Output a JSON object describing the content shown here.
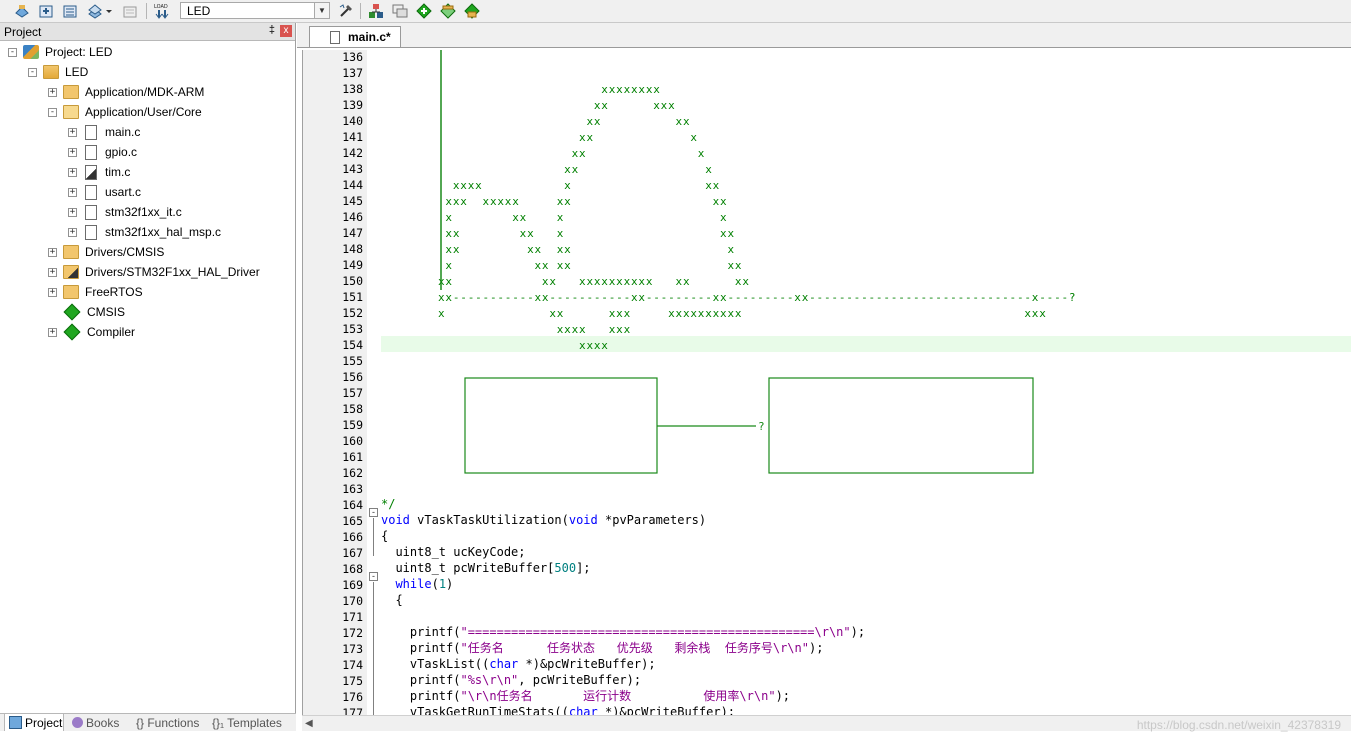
{
  "toolbar": {
    "target": "LED",
    "colors": {
      "accent_green": "#1fa61f",
      "accent_red": "#d9534f"
    }
  },
  "project_panel": {
    "title": "Project",
    "pin_glyph": "‡",
    "close_glyph": "x",
    "tree": [
      {
        "label": "Project: LED",
        "icon": "project-icon",
        "expand": "-"
      },
      {
        "label": "LED",
        "icon": "target-folder-icon",
        "expand": "-"
      },
      {
        "label": "Application/MDK-ARM",
        "icon": "folder-icon",
        "expand": "+"
      },
      {
        "label": "Application/User/Core",
        "icon": "folder-icon",
        "expand": "-"
      },
      {
        "label": "main.c",
        "icon": "file-icon",
        "expand": "+"
      },
      {
        "label": "gpio.c",
        "icon": "file-icon",
        "expand": "+"
      },
      {
        "label": "tim.c",
        "icon": "file-icon",
        "expand": "+"
      },
      {
        "label": "usart.c",
        "icon": "file-icon",
        "expand": "+"
      },
      {
        "label": "stm32f1xx_it.c",
        "icon": "file-icon",
        "expand": "+"
      },
      {
        "label": "stm32f1xx_hal_msp.c",
        "icon": "file-icon",
        "expand": "+"
      },
      {
        "label": "Drivers/CMSIS",
        "icon": "folder-icon",
        "expand": "+"
      },
      {
        "label": "Drivers/STM32F1xx_HAL_Driver",
        "icon": "folder-icon",
        "expand": "+"
      },
      {
        "label": "FreeRTOS",
        "icon": "folder-icon",
        "expand": "+"
      },
      {
        "label": "CMSIS",
        "icon": "component-icon",
        "expand": ""
      },
      {
        "label": "Compiler",
        "icon": "component-icon",
        "expand": "+"
      }
    ],
    "bottom_tabs": [
      "Project",
      "Books",
      "{} Functions",
      "{}₁ Templates"
    ]
  },
  "editor": {
    "tab_label": "main.c*",
    "line_numbers": [
      "136",
      "137",
      "138",
      "139",
      "140",
      "141",
      "142",
      "143",
      "144",
      "145",
      "146",
      "147",
      "148",
      "149",
      "150",
      "151",
      "152",
      "153",
      "154",
      "155",
      "156",
      "157",
      "158",
      "159",
      "160",
      "161",
      "162",
      "163",
      "164",
      "165",
      "166",
      "167",
      "168",
      "169",
      "170",
      "171",
      "172",
      "173",
      "174",
      "175",
      "176",
      "177"
    ],
    "ascii_art": [
      "",
      "",
      "                      xxxxxxxx",
      "                     xx      xxx",
      "                    xx          xx",
      "                   xx             x",
      "                  xx               x",
      "                 xx                 x",
      "  xxxx           x                  xx",
      " xxx  xxxxx     xx                   xx",
      " x        xx    x                     x",
      " xx        xx   x                     xx",
      " xx         xx  xx                     x",
      " x           xx xx                     xx",
      "xx            xx   xxxxxxxxxx   xx      xx",
      "xx-----------xx-----------xx---------xx---------xx------------------------------x----?",
      "x              xx      xxx     xxxxxxxxxx                                      xxx",
      "                xxxx   xxx",
      "                   xxxx"
    ],
    "box_arrow": "?",
    "code": {
      "l164": "*/",
      "l165_kw1": "void",
      "l165_mid": " vTaskTaskUtilization(",
      "l165_kw2": "void",
      "l165_end": " *pvParameters)",
      "l166": "{",
      "l167": "  uint8_t ucKeyCode;",
      "l168_pre": "  uint8_t pcWriteBuffer[",
      "l168_num": "500",
      "l168_post": "];",
      "l169_kw": "  while",
      "l169_p1": "(",
      "l169_num": "1",
      "l169_p2": ")",
      "l170": "  {",
      "l172_pre": "    printf(",
      "l172_str": "\"================================================\\r\\n\"",
      "l172_post": ");",
      "l173_pre": "    printf(",
      "l173_str": "\"任务名      任务状态   优先级   剩余栈  任务序号\\r\\n\"",
      "l173_post": ");",
      "l174_pre": "    vTaskList((",
      "l174_kw": "char",
      "l174_post": " *)&pcWriteBuffer);",
      "l175_pre": "    printf(",
      "l175_str": "\"%s\\r\\n\"",
      "l175_post": ", pcWriteBuffer);",
      "l176_pre": "    printf(",
      "l176_str": "\"\\r\\n任务名       运行计数          使用率\\r\\n\"",
      "l176_post": ");",
      "l177_pre": "    vTaskGetRunTimeStats((",
      "l177_kw": "char",
      "l177_post": " *)&pcWriteBuffer);"
    },
    "watermark": "https://blog.csdn.net/weixin_42378319"
  }
}
